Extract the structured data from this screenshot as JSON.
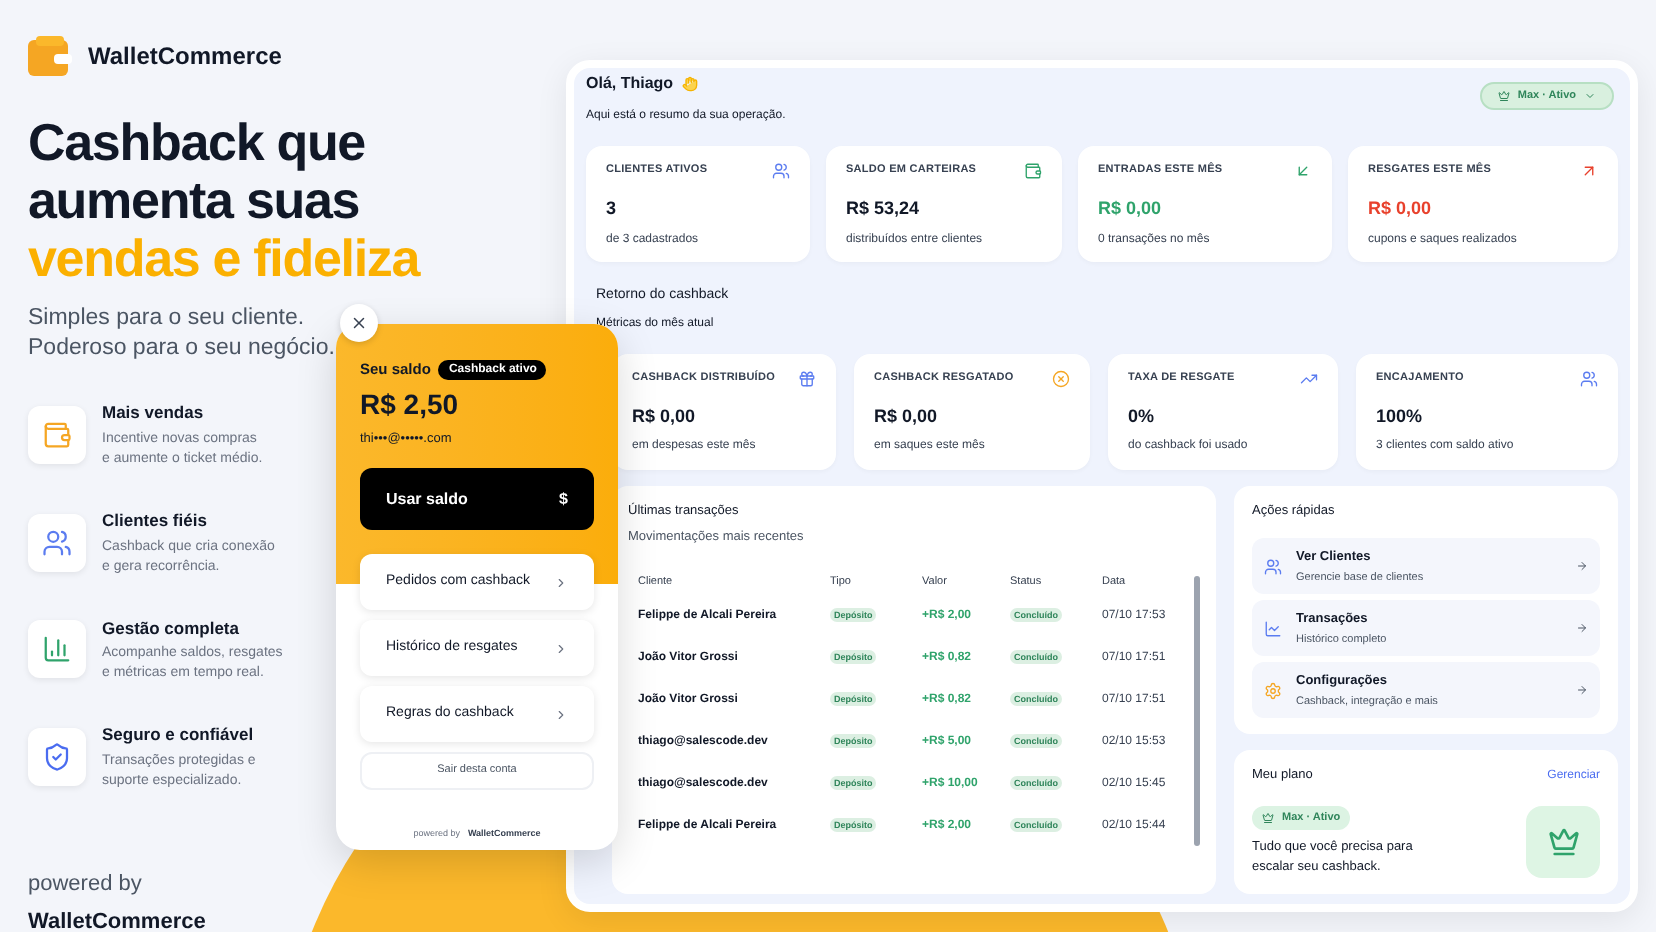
{
  "brand": {
    "name": "WalletCommerce"
  },
  "hero": {
    "title_lines": [
      "Cashback que",
      "aumenta suas"
    ],
    "highlight": "vendas e fideliza",
    "subtitle": [
      "Simples para o seu cliente.",
      "Poderoso para o seu negócio."
    ]
  },
  "features": [
    {
      "kind": "wallet",
      "title": "Mais vendas",
      "description": [
        "Incentive novas compras",
        "e aumente o ticket médio."
      ]
    },
    {
      "kind": "users",
      "title": "Clientes fiéis",
      "description": [
        "Cashback que cria conexão",
        "e gera recorrência."
      ]
    },
    {
      "kind": "chart",
      "title": "Gestão completa",
      "description": [
        "Acompanhe saldos, resgates",
        "e métricas em tempo real."
      ]
    },
    {
      "kind": "shield",
      "title": "Seguro e confiável",
      "description": [
        "Transações protegidas e",
        "suporte especializado."
      ]
    }
  ],
  "powered": {
    "label": "powered by",
    "brand": "WalletCommerce"
  },
  "wallet_widget": {
    "balance_label": "Seu saldo",
    "badge": "Cashback ativo",
    "amount": "R$ 2,50",
    "email": "thi•••@•••••.com",
    "use_button": {
      "label": "Usar saldo",
      "symbol": "$"
    },
    "menu": [
      "Pedidos com cashback",
      "Histórico de resgates",
      "Regras do cashback"
    ],
    "logout": "Sair desta conta",
    "footer": {
      "label": "powered by",
      "brand": "WalletCommerce"
    }
  },
  "dashboard": {
    "greeting": "Olá, Thiago",
    "subtitle": "Aqui está o resumo da sua operação.",
    "plan_pill": "Max · Ativo",
    "stats": [
      {
        "kind": "users",
        "label": "CLIENTES ATIVOS",
        "value": "3",
        "note": "de 3 cadastrados"
      },
      {
        "kind": "wallet",
        "label": "SALDO EM CARTEIRAS",
        "value": "R$ 53,24",
        "note": "distribuídos entre clientes"
      },
      {
        "kind": "in",
        "label": "ENTRADAS ESTE MÊS",
        "value": "R$ 0,00",
        "note": "0 transações no mês",
        "color": "#2fa36b"
      },
      {
        "kind": "out",
        "label": "RESGATES ESTE MÊS",
        "value": "R$ 0,00",
        "note": "cupons e saques realizados",
        "color": "#e8412c"
      }
    ],
    "cashback": {
      "title": "Retorno do cashback",
      "subtitle": "Métricas do mês atual",
      "cards": [
        {
          "kind": "gift",
          "label": "CASHBACK DISTRIBUÍDO",
          "value": "R$ 0,00",
          "note": "em despesas este mês"
        },
        {
          "kind": "cancel",
          "label": "CASHBACK RESGATADO",
          "value": "R$ 0,00",
          "note": "em saques este mês"
        },
        {
          "kind": "trend",
          "label": "TAXA DE RESGATE",
          "value": "0%",
          "note": "do cashback foi usado"
        },
        {
          "kind": "users",
          "label": "ENCAJAMENTO",
          "value": "100%",
          "note": "3 clientes com saldo ativo"
        }
      ]
    },
    "transactions": {
      "title": "Últimas transações",
      "subtitle": "Movimentações mais recentes",
      "columns": [
        "Cliente",
        "Tipo",
        "Valor",
        "Status",
        "Data"
      ],
      "rows": [
        {
          "client": "Felippe de Alcali Pereira",
          "type": "Depósito",
          "value": "+R$ 2,00",
          "status": "Concluído",
          "date": "07/10 17:53"
        },
        {
          "client": "João Vitor Grossi",
          "type": "Depósito",
          "value": "+R$ 0,82",
          "status": "Concluído",
          "date": "07/10 17:51"
        },
        {
          "client": "João Vitor Grossi",
          "type": "Depósito",
          "value": "+R$ 0,82",
          "status": "Concluído",
          "date": "07/10 17:51"
        },
        {
          "client": "thiago@salescode.dev",
          "type": "Depósito",
          "value": "+R$ 5,00",
          "status": "Concluído",
          "date": "02/10 15:53"
        },
        {
          "client": "thiago@salescode.dev",
          "type": "Depósito",
          "value": "+R$ 10,00",
          "status": "Concluído",
          "date": "02/10 15:45"
        },
        {
          "client": "Felippe de Alcali Pereira",
          "type": "Depósito",
          "value": "+R$ 2,00",
          "status": "Concluído",
          "date": "02/10 15:44"
        }
      ]
    },
    "quick_actions": {
      "title": "Ações rápidas",
      "items": [
        {
          "kind": "users",
          "title": "Ver Clientes",
          "description": "Gerencie base de clientes"
        },
        {
          "kind": "chart",
          "title": "Transações",
          "description": "Histórico completo"
        },
        {
          "kind": "settings",
          "title": "Configurações",
          "description": "Cashback, integração e mais"
        }
      ]
    },
    "plan": {
      "title": "Meu plano",
      "manage_link": "Gerenciar",
      "badge": "Max · Ativo",
      "description": [
        "Tudo que você precisa para",
        "escalar seu cashback."
      ]
    }
  }
}
